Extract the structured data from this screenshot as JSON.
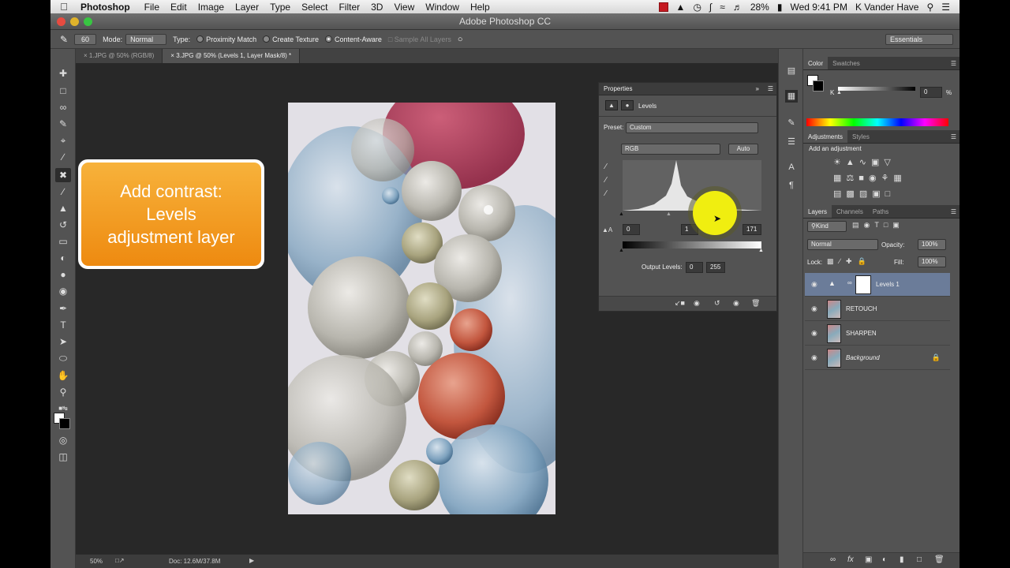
{
  "menubar": {
    "apple": "",
    "items": [
      "Photoshop",
      "File",
      "Edit",
      "Image",
      "Layer",
      "Type",
      "Select",
      "Filter",
      "3D",
      "View",
      "Window",
      "Help"
    ],
    "battery": "28%",
    "clock": "Wed 9:41 PM",
    "user": "K Vander Have"
  },
  "window": {
    "title": "Adobe Photoshop CC"
  },
  "options": {
    "brush_size": "60",
    "mode_label": "Mode:",
    "mode_value": "Normal",
    "type_label": "Type:",
    "type_options": [
      "Proximity Match",
      "Create Texture",
      "Content-Aware"
    ],
    "type_selected": "Content-Aware",
    "sample_all": "Sample All Layers",
    "workspace": "Essentials"
  },
  "tabs": [
    {
      "label": "1.JPG @ 50% (RGB/8)",
      "active": false
    },
    {
      "label": "3.JPG @ 50% (Levels 1, Layer Mask/8) *",
      "active": true
    }
  ],
  "callout": {
    "lines": [
      "Add contrast:",
      "Levels",
      "adjustment layer"
    ],
    "color": "#f29a1f"
  },
  "statusbar": {
    "zoom": "50%",
    "doc": "Doc: 12.6M/37.8M"
  },
  "properties": {
    "title": "Properties",
    "adjustment": "Levels",
    "preset_label": "Preset:",
    "preset_value": "Custom",
    "channel": "RGB",
    "auto": "Auto",
    "input_black": "0",
    "input_mid": "1",
    "input_white": "171",
    "output_label": "Output Levels:",
    "output_black": "0",
    "output_white": "255"
  },
  "color_panel": {
    "tabs": [
      "Color",
      "Swatches"
    ],
    "channel_label": "K",
    "value": "0",
    "unit": "%"
  },
  "adjustments_panel": {
    "tabs": [
      "Adjustments",
      "Styles"
    ],
    "heading": "Add an adjustment"
  },
  "layers_panel": {
    "tabs": [
      "Layers",
      "Channels",
      "Paths"
    ],
    "filter": "Kind",
    "blend": "Normal",
    "opacity_label": "Opacity:",
    "opacity": "100%",
    "lock_label": "Lock:",
    "fill_label": "Fill:",
    "fill": "100%",
    "layers": [
      {
        "name": "Levels 1",
        "selected": true
      },
      {
        "name": "RETOUCH",
        "selected": false
      },
      {
        "name": "SHARPEN",
        "selected": false
      },
      {
        "name": "Background",
        "selected": false,
        "locked": true
      }
    ]
  }
}
